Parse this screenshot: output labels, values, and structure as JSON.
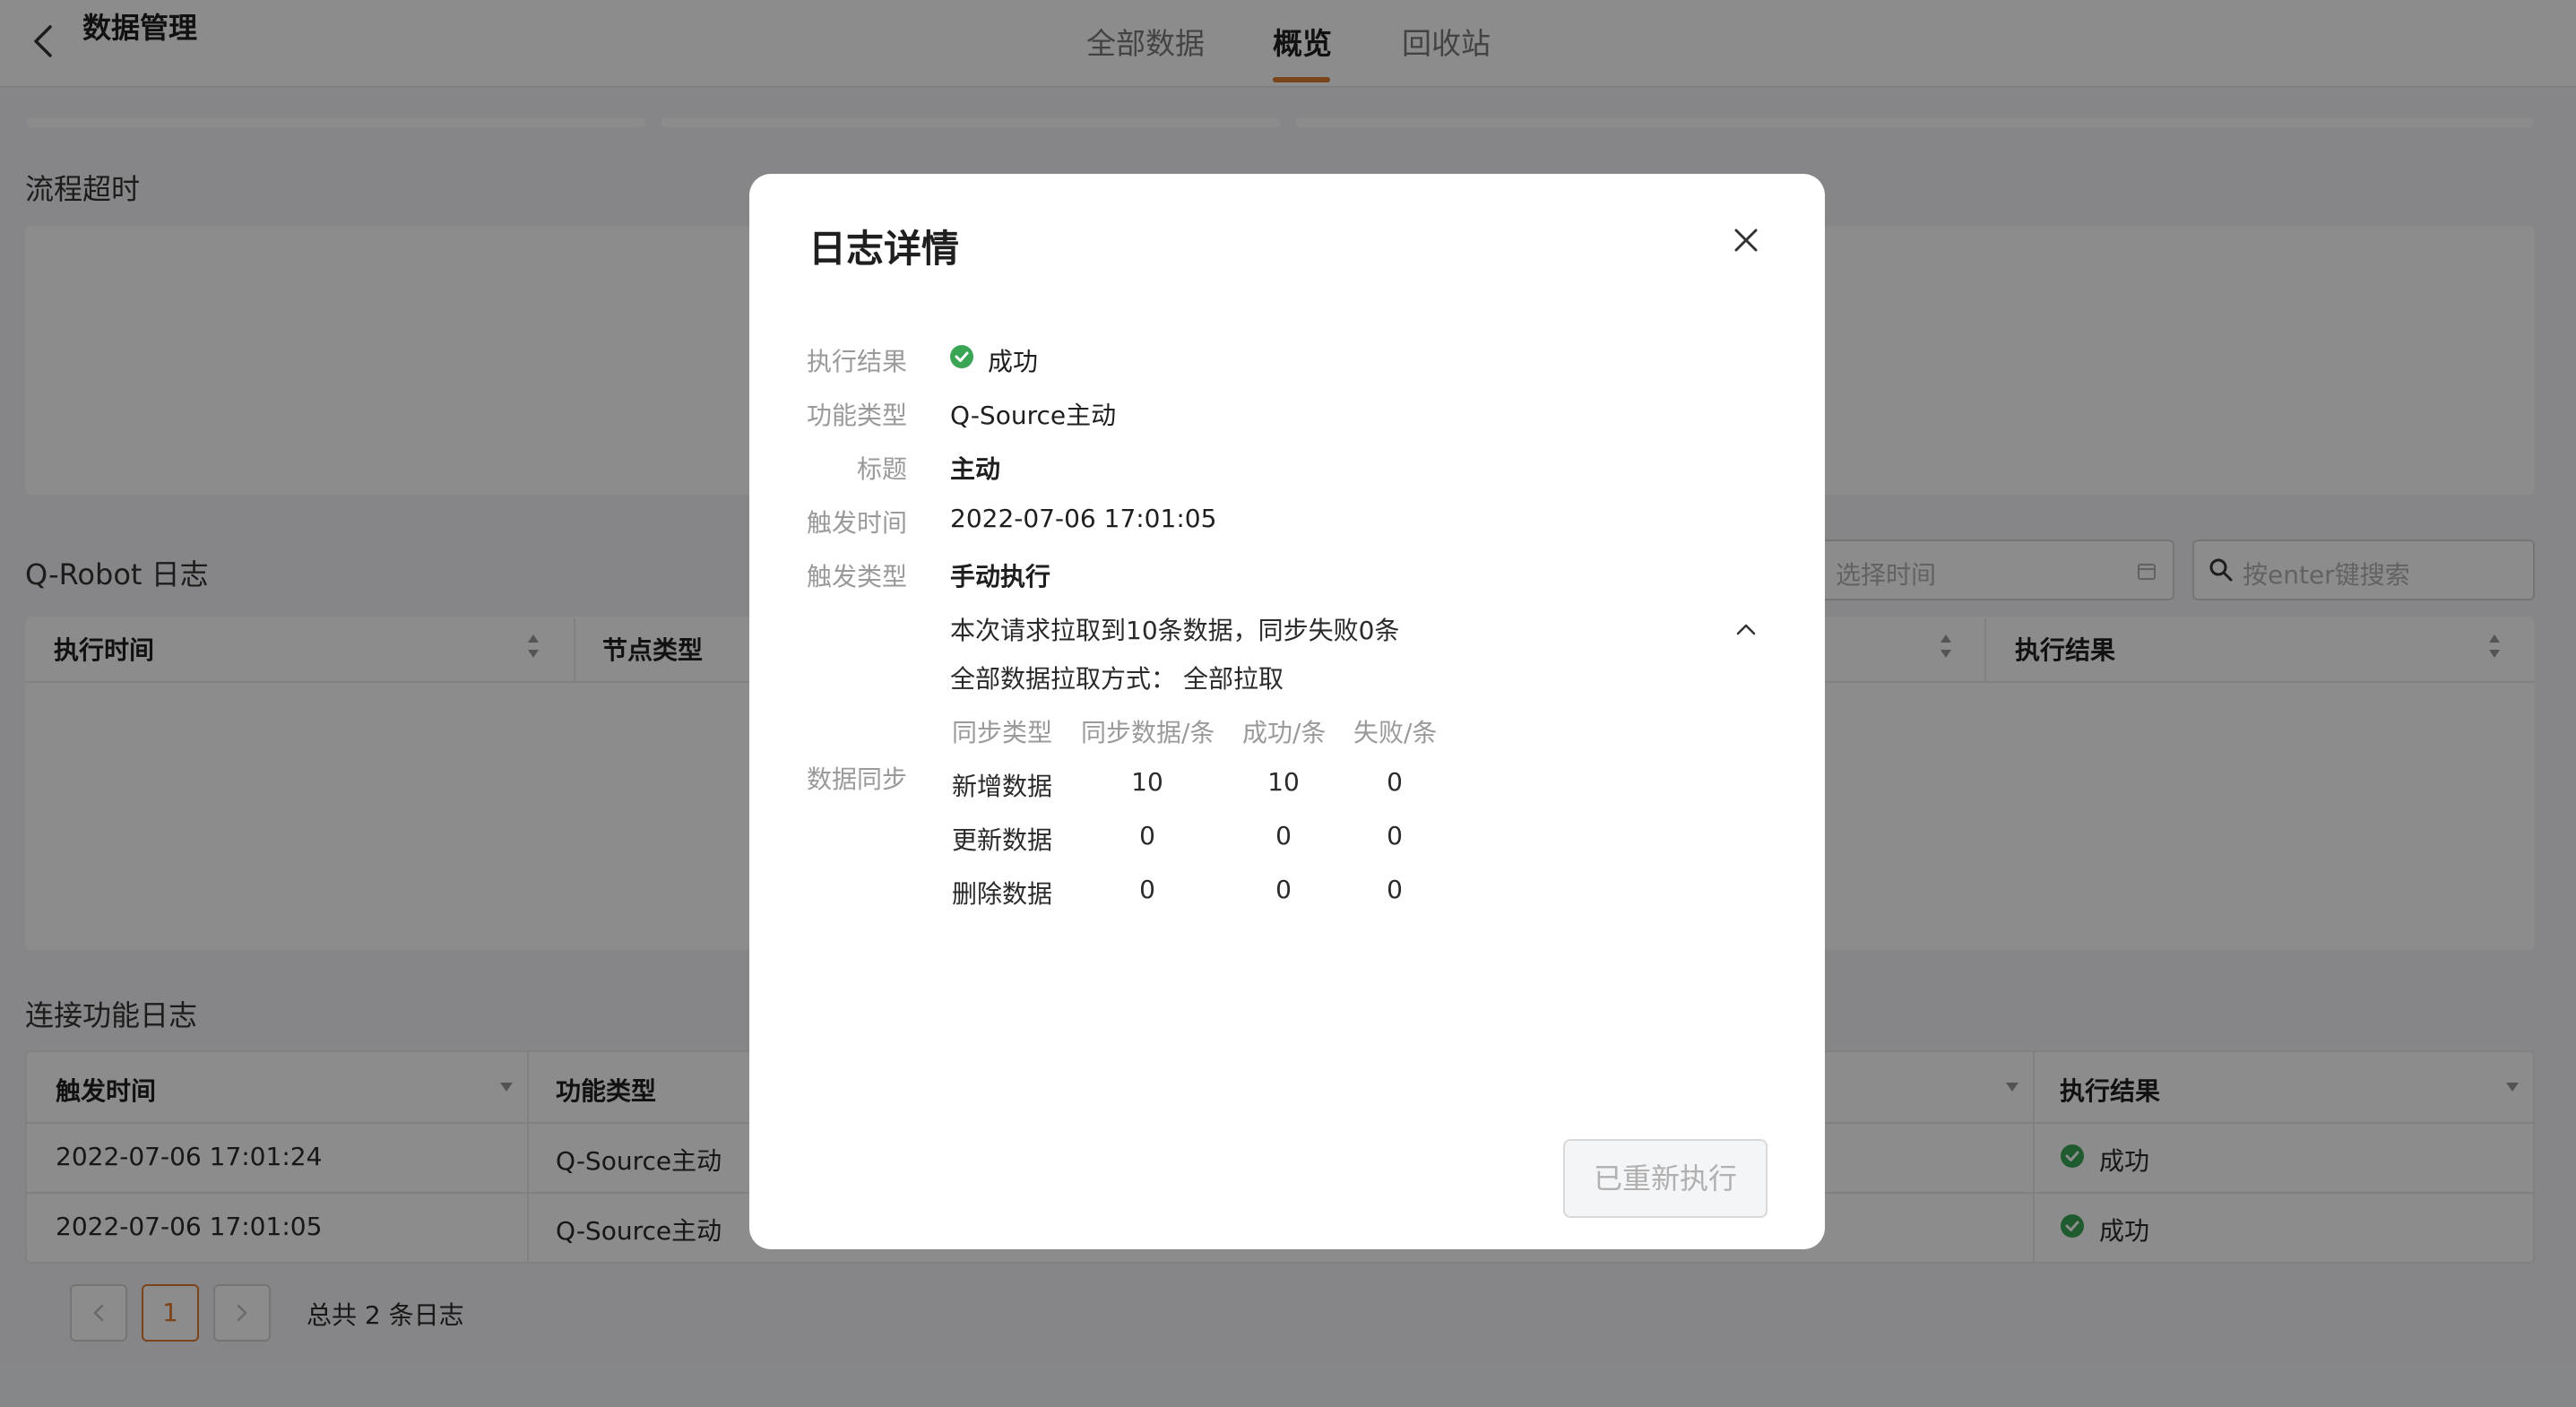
{
  "header": {
    "title": "数据管理",
    "tabs": [
      {
        "label": "全部数据"
      },
      {
        "label": "概览"
      },
      {
        "label": "回收站"
      }
    ]
  },
  "sections": {
    "flow_timeout": "流程超时",
    "qrobot_log": "Q-Robot 日志",
    "connect_log": "连接功能日志"
  },
  "qrobot": {
    "columns": [
      "执行时间",
      "节点类型",
      "执行结果"
    ],
    "time_placeholder": "选择时间",
    "search_placeholder": "按enter键搜索"
  },
  "connect": {
    "columns": [
      "触发时间",
      "功能类型",
      "执行结果"
    ],
    "rows": [
      {
        "time": "2022-07-06 17:01:24",
        "type": "Q-Source主动",
        "result": "成功"
      },
      {
        "time": "2022-07-06 17:01:05",
        "type": "Q-Source主动",
        "result": "成功"
      }
    ]
  },
  "pager": {
    "page": "1",
    "total_text": "总共 2 条日志"
  },
  "modal": {
    "title": "日志详情",
    "fields": [
      {
        "label": "执行结果",
        "value": "成功"
      },
      {
        "label": "功能类型",
        "value": "Q-Source主动"
      },
      {
        "label": "标题",
        "value": "主动"
      },
      {
        "label": "触发时间",
        "value": "2022-07-06 17:01:05"
      },
      {
        "label": "触发类型",
        "value": "手动执行"
      }
    ],
    "sync": {
      "label": "数据同步",
      "summary": "本次请求拉取到10条数据，同步失败0条",
      "pull_mode_label": "全部数据拉取方式：",
      "pull_mode_value": "全部拉取",
      "columns": [
        "同步类型",
        "同步数据/条",
        "成功/条",
        "失败/条"
      ],
      "rows": [
        {
          "type": "新增数据",
          "total": "10",
          "success": "10",
          "fail": "0"
        },
        {
          "type": "更新数据",
          "total": "0",
          "success": "0",
          "fail": "0"
        },
        {
          "type": "删除数据",
          "total": "0",
          "success": "0",
          "fail": "0"
        }
      ]
    },
    "button_label": "已重新执行"
  },
  "colors": {
    "accent": "#e07a2f",
    "success": "#3aa655"
  }
}
